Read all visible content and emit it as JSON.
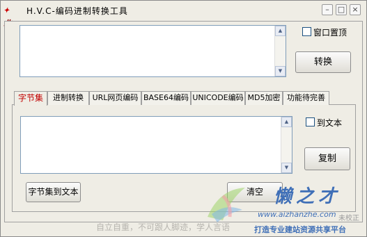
{
  "window": {
    "title": "H.V.C-编码进制转换工具",
    "icon_text": "北",
    "min_label": "–",
    "max_label": "□",
    "close_label": "×"
  },
  "top": {
    "pin_window_label": "窗口置顶",
    "pin_window_checked": false,
    "convert_label": "转换",
    "input_value": ""
  },
  "tabs": [
    {
      "label": "字节集",
      "active": true
    },
    {
      "label": "进制转换",
      "active": false
    },
    {
      "label": "URL网页编码",
      "active": false
    },
    {
      "label": "BASE64编码",
      "active": false
    },
    {
      "label": "UNICODE编码",
      "active": false
    },
    {
      "label": "MD5加密",
      "active": false
    },
    {
      "label": "功能待完善",
      "active": false
    }
  ],
  "panel": {
    "output_value": "",
    "to_text_label": "到文本",
    "to_text_checked": false,
    "copy_label": "复制",
    "charset_to_text_label": "字节集到文本",
    "clear_label": "清空"
  },
  "status": {
    "text": "自立自重，不可跟人脚迹，学人言语"
  },
  "watermark": {
    "brand": "懒之才",
    "url": "www.aizhanzhe.com",
    "slogan": "打造专业建站资源共享平台",
    "clock": "未校正"
  },
  "colors": {
    "window_bg": "#efede5",
    "active_tab_text": "#c00000",
    "textarea_border": "#7f9db9",
    "watermark_blue": "#3f6fb7"
  }
}
